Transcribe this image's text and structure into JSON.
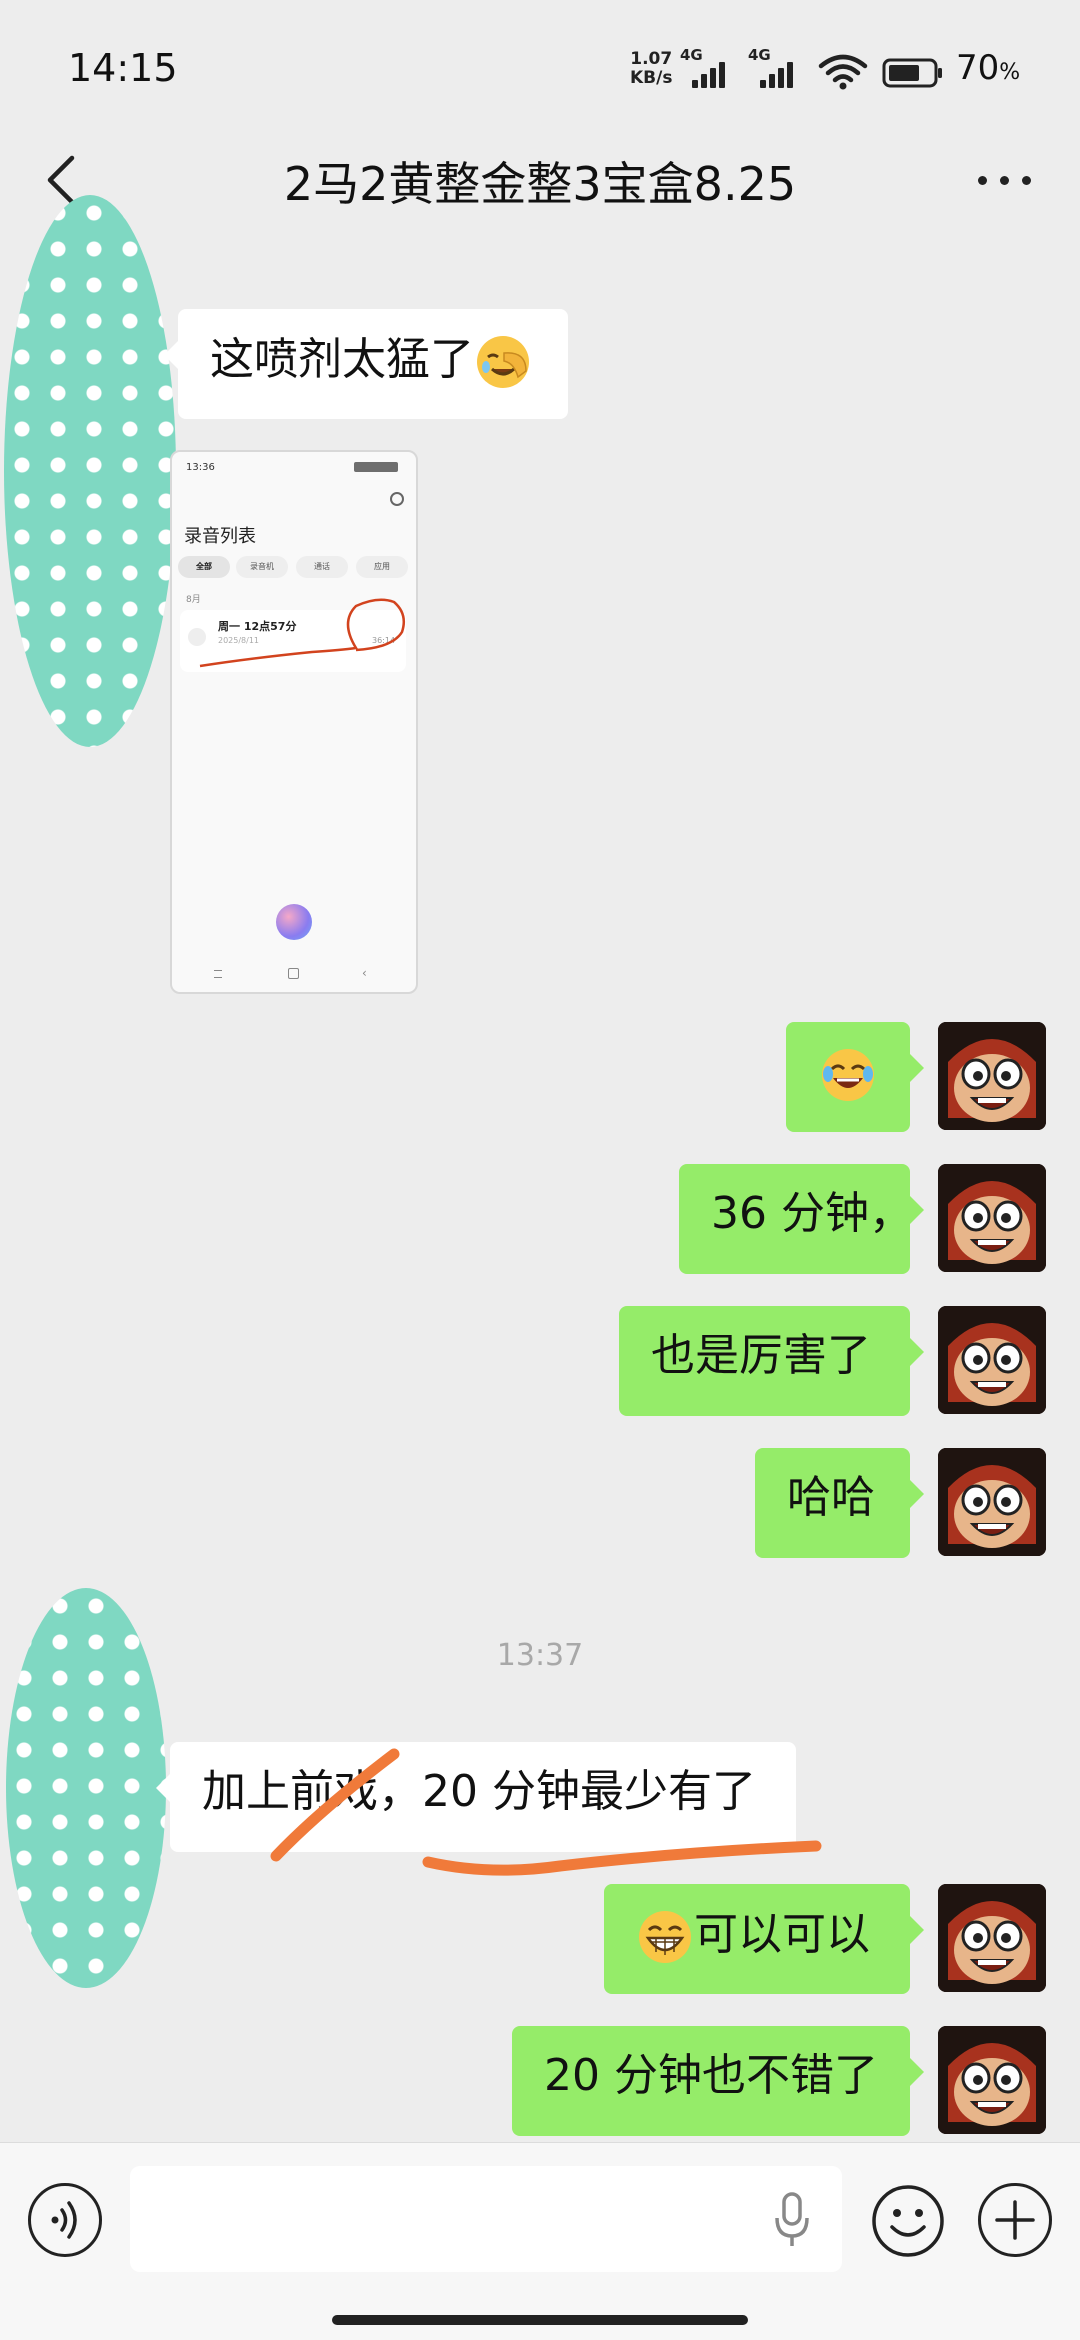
{
  "status_bar": {
    "time": "14:15",
    "net_speed_value": "1.07",
    "net_speed_unit": "KB/s",
    "sim1_label": "4G",
    "sim2_label": "4G",
    "battery_percent": "70",
    "battery_unit": "%"
  },
  "header": {
    "title": "2马2黄整金整3宝盒8.25"
  },
  "messages": {
    "m1": "这喷剂太猛了",
    "m3": "36 分钟，",
    "m4": "也是厉害了",
    "m5": "哈哈",
    "timestamp": "13:37",
    "m6": "加上前戏，20 分钟最少有了",
    "m7": "可以可以",
    "m8": "20 分钟也不错了"
  },
  "screenshot": {
    "time": "13:36",
    "title": "录音列表",
    "tabs": [
      "全部",
      "录音机",
      "通话",
      "应用"
    ],
    "month": "8月",
    "record_title": "周一 12点57分",
    "record_date": "2025/8/11",
    "record_duration": "36:14"
  },
  "input": {
    "placeholder": ""
  },
  "colors": {
    "background": "#ededed",
    "bubble_out": "#95ec69",
    "bubble_in": "#ffffff",
    "annotation": "#f07a3a",
    "avatar_left": "#7fd8c2"
  }
}
